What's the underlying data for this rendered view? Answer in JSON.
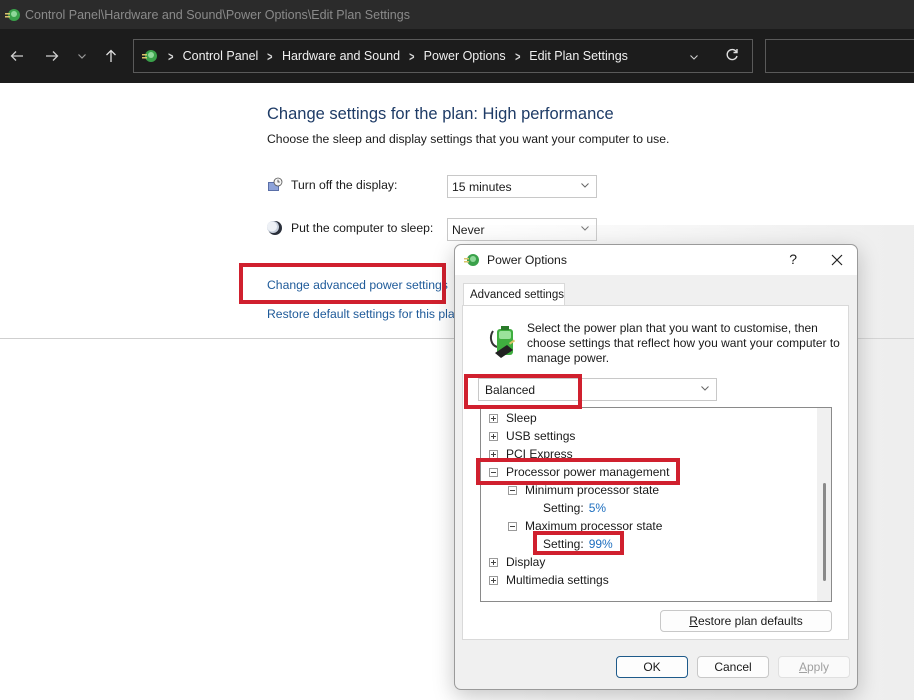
{
  "window": {
    "title": "Control Panel\\Hardware and Sound\\Power Options\\Edit Plan Settings"
  },
  "navbar": {
    "back_icon": "arrow-left-icon",
    "forward_icon": "arrow-right-icon",
    "recent_icon": "chevron-down-icon",
    "up_icon": "arrow-up-icon",
    "breadcrumbs": [
      "Control Panel",
      "Hardware and Sound",
      "Power Options",
      "Edit Plan Settings"
    ],
    "refresh_icon": "refresh-icon",
    "search_placeholder": ""
  },
  "main": {
    "title": "Change settings for the plan: High performance",
    "subtitle": "Choose the sleep and display settings that you want your computer to use.",
    "settings": [
      {
        "label": "Turn off the display:",
        "value": "15 minutes",
        "icon": "monitor-clock-icon"
      },
      {
        "label": "Put the computer to sleep:",
        "value": "Never",
        "icon": "moon-icon"
      }
    ],
    "links": {
      "advanced": "Change advanced power settings",
      "restore": "Restore default settings for this plan"
    },
    "highlight_color": "#d0202e"
  },
  "dialog": {
    "title": "Power Options",
    "help_label": "?",
    "tab_label": "Advanced settings",
    "description": "Select the power plan that you want to customise, then choose settings that reflect how you want your computer to manage power.",
    "plan_selected": "Balanced",
    "tree": [
      {
        "label": "Sleep",
        "state": "collapsed",
        "level": 0
      },
      {
        "label": "USB settings",
        "state": "collapsed",
        "level": 0
      },
      {
        "label": "PCI Express",
        "state": "collapsed",
        "level": 0
      },
      {
        "label": "Processor power management",
        "state": "expanded",
        "level": 0
      },
      {
        "label": "Minimum processor state",
        "state": "expanded",
        "level": 1
      },
      {
        "label": "Setting:",
        "value": "5%",
        "level": 2
      },
      {
        "label": "Maximum processor state",
        "state": "expanded",
        "level": 1
      },
      {
        "label": "Setting:",
        "value": "99%",
        "level": 2
      },
      {
        "label": "Display",
        "state": "collapsed",
        "level": 0
      },
      {
        "label": "Multimedia settings",
        "state": "collapsed",
        "level": 0
      }
    ],
    "buttons": {
      "restore_prefix": "R",
      "restore_rest": "estore plan defaults",
      "ok": "OK",
      "cancel": "Cancel",
      "apply_prefix": "A",
      "apply_rest": "pply"
    }
  }
}
